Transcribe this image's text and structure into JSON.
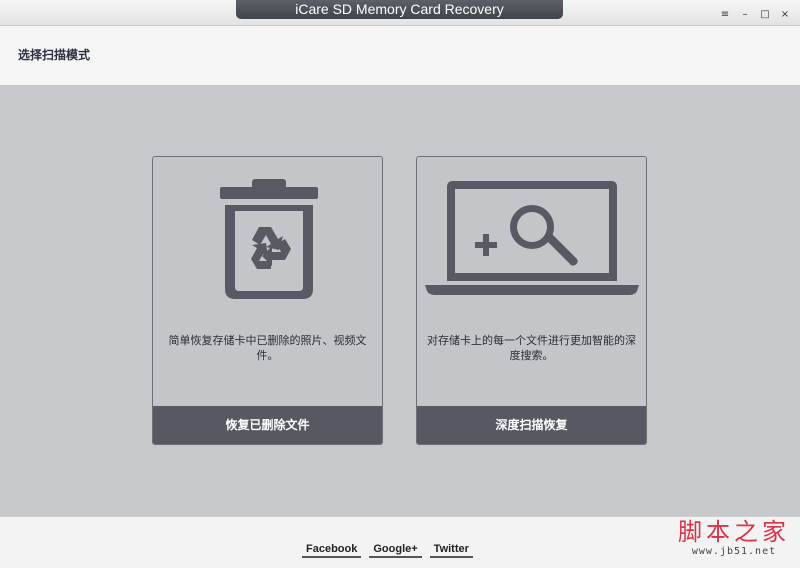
{
  "window": {
    "title": "iCare SD Memory Card Recovery",
    "controls": [
      "≡",
      "–",
      "□",
      "×"
    ]
  },
  "header": {
    "title": "选择扫描模式"
  },
  "cards": [
    {
      "icon": "recycle-bin-icon",
      "description": "简单恢复存储卡中已删除的照片、视频文件。",
      "button": "恢复已删除文件"
    },
    {
      "icon": "laptop-deep-search-icon",
      "description": "对存储卡上的每一个文件进行更加智能的深度搜索。",
      "button": "深度扫描恢复"
    }
  ],
  "footer": {
    "links": [
      "Facebook",
      "Google+",
      "Twitter"
    ]
  },
  "watermark": {
    "title": "脚本之家",
    "url": "www.jb51.net"
  },
  "colors": {
    "accent": "#565961",
    "panel": "#c6c8cc",
    "watermark": "#d9334a"
  }
}
